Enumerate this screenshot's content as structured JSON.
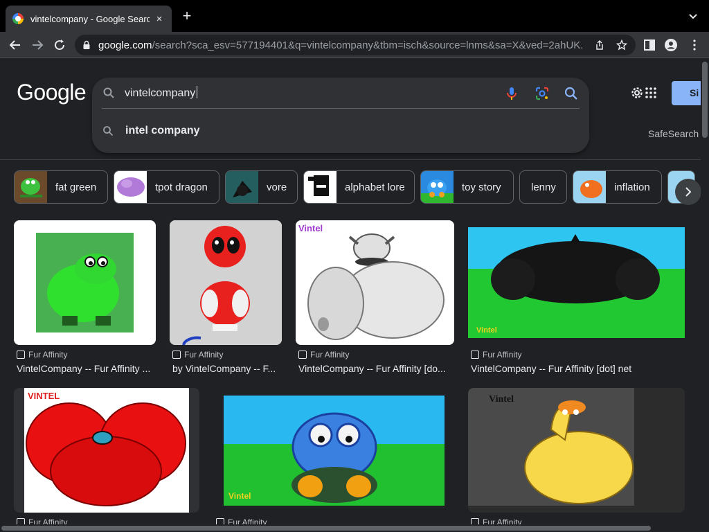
{
  "browser": {
    "tab_title": "vintelcompany - Google Search",
    "new_tab": "+",
    "tab_close": "×",
    "url_domain": "google.com",
    "url_rest": "/search?sca_esv=577194401&q=vintelcompany&tbm=isch&source=lnms&sa=X&ved=2ahUK..."
  },
  "header": {
    "logo": "Google",
    "query": "vintelcompany",
    "suggestion": "intel company",
    "signin_label": "Si",
    "safesearch": "SafeSearch"
  },
  "chips": [
    {
      "label": "fat green",
      "thumb": "green"
    },
    {
      "label": "tpot dragon",
      "thumb": "purple"
    },
    {
      "label": "vore",
      "thumb": "teal"
    },
    {
      "label": "alphabet lore",
      "thumb": "white"
    },
    {
      "label": "toy story",
      "thumb": "blue"
    },
    {
      "label": "lenny",
      "thumb": ""
    },
    {
      "label": "inflation",
      "thumb": "lightblue"
    }
  ],
  "results": [
    {
      "source": "Fur Affinity",
      "title": "VintelCompany -- Fur Affinity ..."
    },
    {
      "source": "Fur Affinity",
      "title": "by VintelCompany -- F..."
    },
    {
      "source": "Fur Affinity",
      "title": "VintelCompany -- Fur Affinity [do..."
    },
    {
      "source": "Fur Affinity",
      "title": "VintelCompany -- Fur Affinity [dot] net"
    },
    {
      "source": "Fur Affinity",
      "title": ""
    },
    {
      "source": "Fur Affinity",
      "title": ""
    },
    {
      "source": "Fur Affinity",
      "title": ""
    }
  ],
  "image_text": {
    "vintel": "Vintel",
    "vintel_upper": "VINTEL"
  },
  "colors": {
    "page_bg": "#202124",
    "accent_blue": "#8ab4f8",
    "chip_border": "#5f6368"
  }
}
